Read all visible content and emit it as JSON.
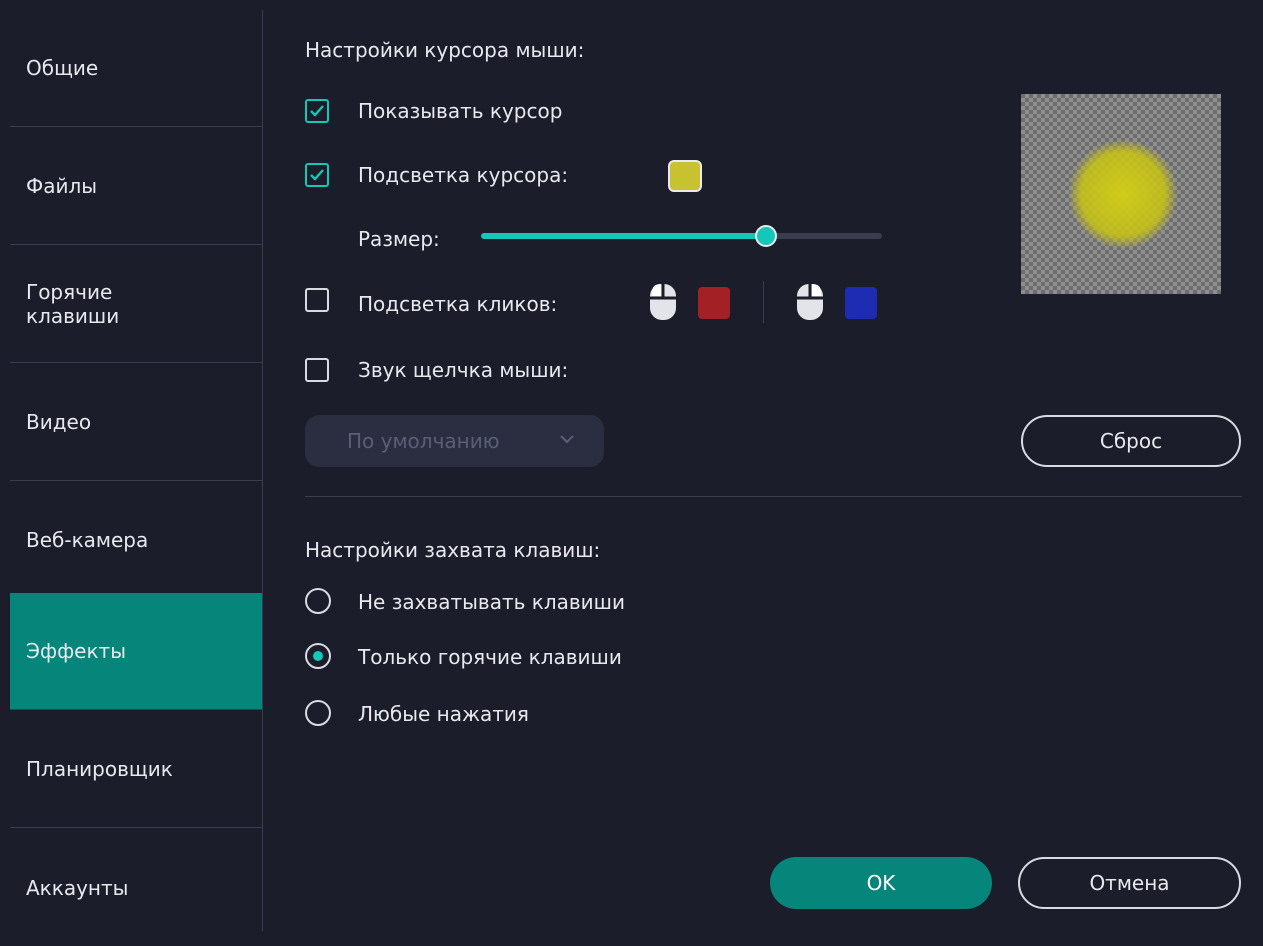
{
  "sidebar": {
    "items": [
      {
        "label": "Общие"
      },
      {
        "label": "Файлы"
      },
      {
        "label": "Горячие\nклавиши"
      },
      {
        "label": "Видео"
      },
      {
        "label": "Веб-камера"
      },
      {
        "label": "Эффекты",
        "active": true
      },
      {
        "label": "Планировщик"
      },
      {
        "label": "Аккаунты"
      }
    ]
  },
  "cursor": {
    "section_title": "Настройки курсора мыши:",
    "show_cursor": {
      "label": "Показывать курсор",
      "checked": true
    },
    "highlight": {
      "label": "Подсветка курсора:",
      "checked": true,
      "color": "#c8c230"
    },
    "size": {
      "label": "Размер:",
      "value": 0.71
    },
    "clicks": {
      "label": "Подсветка кликов:",
      "checked": false,
      "left_color": "#a32024",
      "right_color": "#1e2cb4"
    },
    "sound": {
      "label": "Звук щелчка мыши:",
      "checked": false
    },
    "sound_select": {
      "value": "По умолчанию",
      "disabled": true
    },
    "reset_label": "Сброс"
  },
  "keys": {
    "section_title": "Настройки захвата клавиш:",
    "options": [
      {
        "label": "Не захватывать клавиши",
        "selected": false
      },
      {
        "label": "Только горячие клавиши",
        "selected": true
      },
      {
        "label": "Любые нажатия",
        "selected": false
      }
    ]
  },
  "footer": {
    "ok_label": "OK",
    "cancel_label": "Отмена"
  },
  "colors": {
    "accent": "#14c7b8",
    "active_bg": "#06857a",
    "background": "#1b1d2a"
  }
}
